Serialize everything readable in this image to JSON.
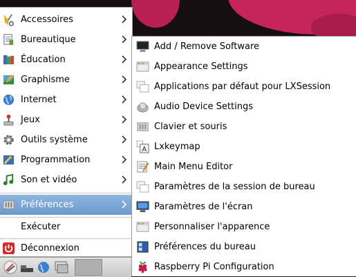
{
  "menu": {
    "categories": [
      {
        "label": "Accessoires",
        "icon": "accessories-icon"
      },
      {
        "label": "Bureautique",
        "icon": "office-icon"
      },
      {
        "label": "Éducation",
        "icon": "education-icon"
      },
      {
        "label": "Graphisme",
        "icon": "graphics-icon"
      },
      {
        "label": "Internet",
        "icon": "internet-globe-icon"
      },
      {
        "label": "Jeux",
        "icon": "games-joystick-icon"
      },
      {
        "label": "Outils système",
        "icon": "system-tools-gear-icon"
      },
      {
        "label": "Programmation",
        "icon": "programming-icon"
      },
      {
        "label": "Son et vidéo",
        "icon": "sound-video-icon"
      }
    ],
    "preferences": {
      "label": "Préférences",
      "icon": "preferences-icon"
    },
    "run": {
      "label": "Exécuter"
    },
    "logout": {
      "label": "Déconnexion",
      "icon": "power-icon"
    }
  },
  "submenu": {
    "items": [
      {
        "label": "Add / Remove Software",
        "icon": "monitor-icon"
      },
      {
        "label": "Appearance Settings",
        "icon": "appearance-window-icon"
      },
      {
        "label": "Applications par défaut pour LXSession",
        "icon": "default-apps-window-icon"
      },
      {
        "label": "Audio Device Settings",
        "icon": "audio-device-icon"
      },
      {
        "label": "Clavier et souris",
        "icon": "keyboard-mouse-icon"
      },
      {
        "label": "Lxkeymap",
        "icon": "keymap-icon"
      },
      {
        "label": "Main Menu Editor",
        "icon": "menu-editor-icon"
      },
      {
        "label": "Paramètres de la session de bureau",
        "icon": "session-window-icon"
      },
      {
        "label": "Paramètres de l'écran",
        "icon": "display-monitor-icon"
      },
      {
        "label": "Personnaliser l'apparence",
        "icon": "customize-appearance-icon"
      },
      {
        "label": "Préférences du bureau",
        "icon": "desktop-preferences-icon"
      },
      {
        "label": "Raspberry Pi Configuration",
        "icon": "raspberry-pi-icon"
      }
    ]
  },
  "colors": {
    "selected": "#7aa3d4",
    "wallpaper_accent": "#c4245a"
  }
}
